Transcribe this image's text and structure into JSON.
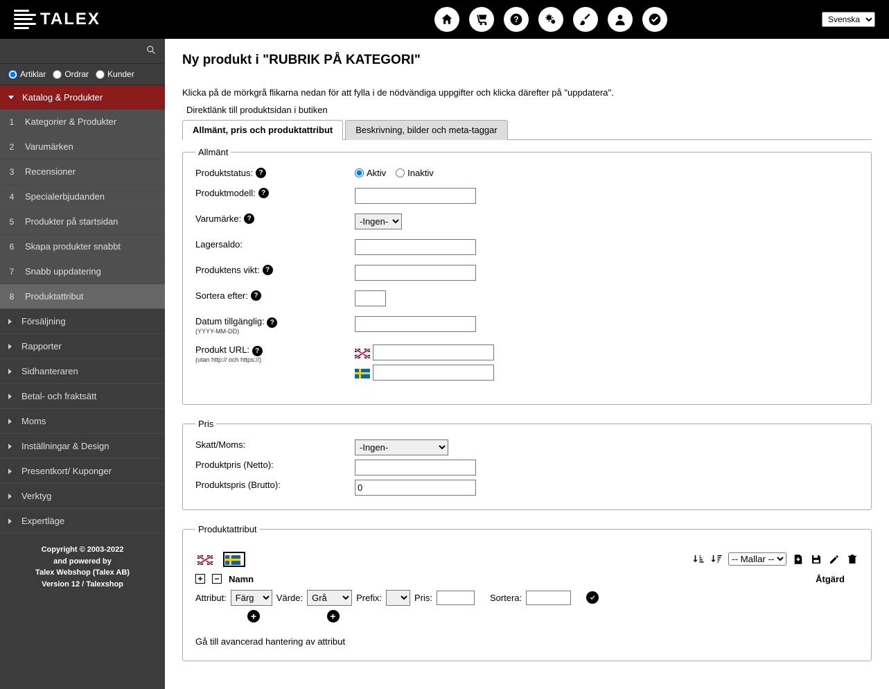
{
  "logo_text": "TALEX",
  "lang": "Svenska",
  "sidebar": {
    "radios": {
      "artiklar": "Artiklar",
      "ordrar": "Ordrar",
      "kunder": "Kunder"
    },
    "catalog": "Katalog & Produkter",
    "subs": [
      {
        "n": "1",
        "t": "Kategorier & Produkter"
      },
      {
        "n": "2",
        "t": "Varumärken"
      },
      {
        "n": "3",
        "t": "Recensioner"
      },
      {
        "n": "4",
        "t": "Specialerbjudanden"
      },
      {
        "n": "5",
        "t": "Produkter på startsidan"
      },
      {
        "n": "6",
        "t": "Skapa produkter snabbt"
      },
      {
        "n": "7",
        "t": "Snabb uppdatering"
      },
      {
        "n": "8",
        "t": "Produktattribut"
      }
    ],
    "sections": [
      "Försäljning",
      "Rapporter",
      "Sidhanteraren",
      "Betal- och fraktsätt",
      "Moms",
      "Inställningar & Design",
      "Presentkort/ Kuponger",
      "Verktyg",
      "Expertläge"
    ]
  },
  "footer": {
    "l1": "Copyright © 2003-2022",
    "l2": "and powered by",
    "l3": "Talex Webshop (Talex AB)",
    "l4": "Version 12 / Talexshop"
  },
  "title": "Ny produkt i \"RUBRIK PÅ KATEGORI\"",
  "intro": "Klicka på de mörkgrå flikarna nedan för att fylla i de nödvändiga uppgifter och klicka därefter på \"uppdatera\".",
  "directlink": "Direktlänk till produktsidan i butiken",
  "tabs": {
    "general": "Allmänt, pris och produktattribut",
    "desc": "Beskrivning, bilder och meta-taggar"
  },
  "fs": {
    "general": "Allmänt",
    "status_lbl": "Produktstatus:",
    "status_active": "Aktiv",
    "status_inactive": "Inaktiv",
    "model": "Produktmodell:",
    "brand": "Varumärke:",
    "brand_none": "-Ingen-",
    "stock": "Lagersaldo:",
    "weight": "Produktens vikt:",
    "sort": "Sortera efter:",
    "date": "Datum tillgänglig:",
    "date_fmt": "(YYYY-MM-DD)",
    "url": "Produkt URL:",
    "url_sub": "(utan http:// och https://)"
  },
  "price": {
    "legend": "Pris",
    "tax": "Skatt/Moms:",
    "tax_none": "-Ingen-",
    "net": "Produktpris (Netto):",
    "gross": "Produktspris (Brutto):",
    "gross_val": "0"
  },
  "attr": {
    "legend": "Produktattribut",
    "templates": "-- Mallar --",
    "name": "Namn",
    "action": "Åtgärd",
    "attribut": "Attribut:",
    "farg": "Färg",
    "value": "Värde:",
    "gra": "Grå",
    "prefix": "Prefix:",
    "pris": "Pris:",
    "sort": "Sortera:",
    "advlink": "Gå till avancerad hantering av attribut"
  }
}
